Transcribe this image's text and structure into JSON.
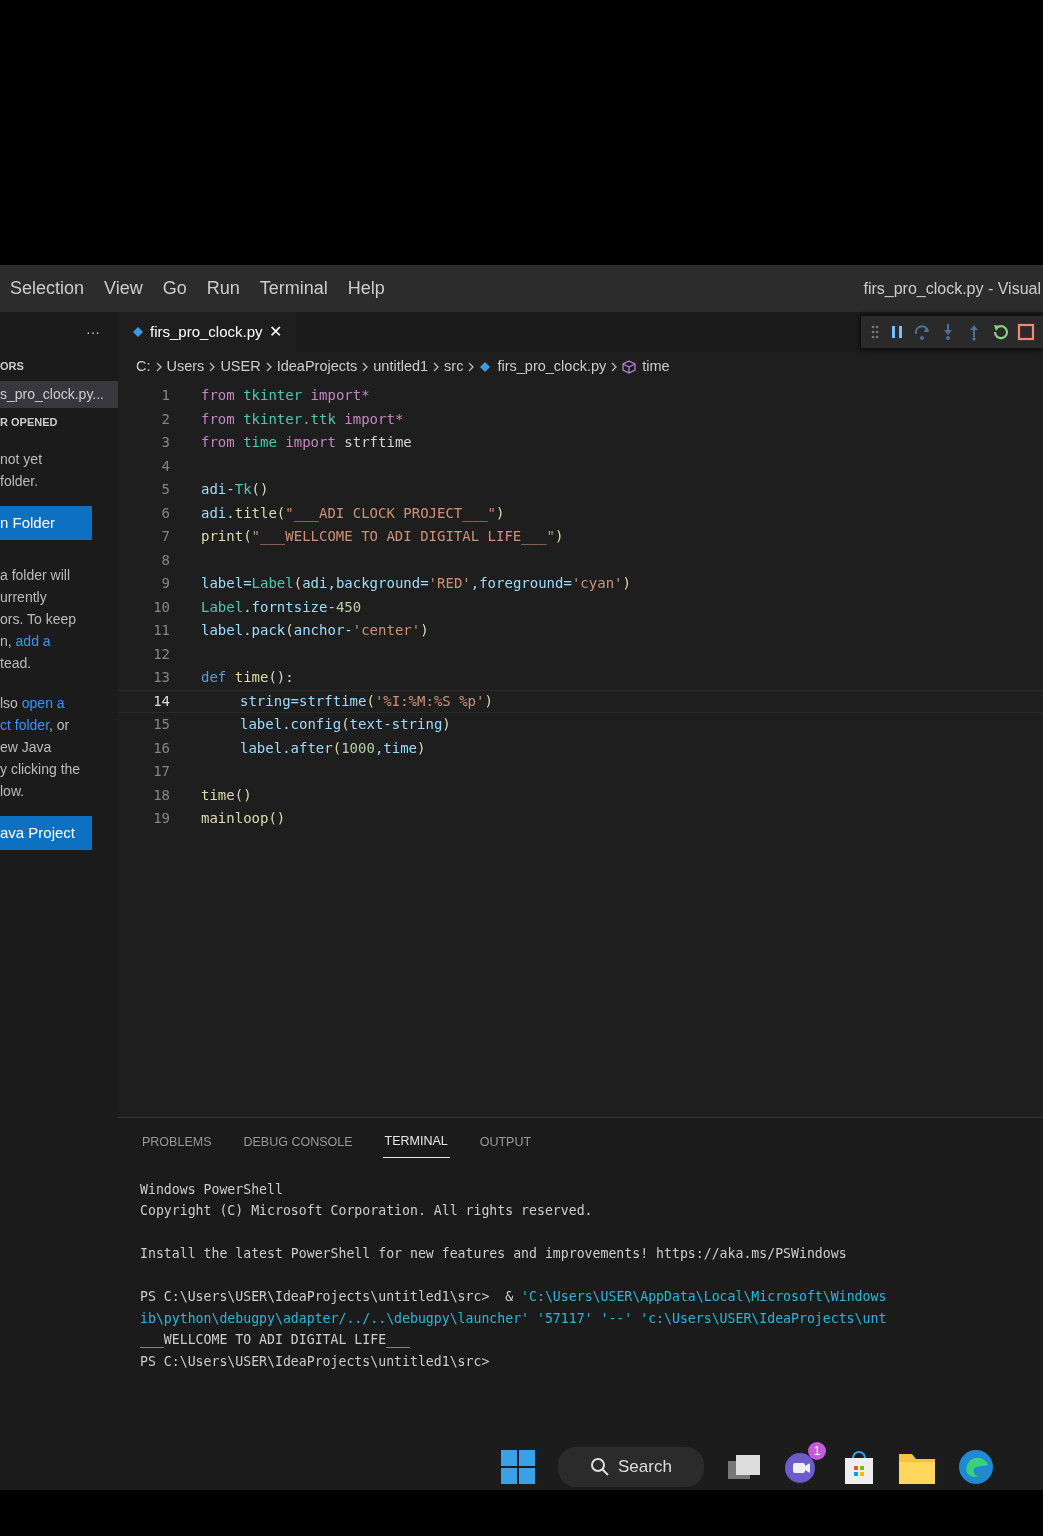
{
  "menu": [
    {
      "label": "Selection"
    },
    {
      "label": "View"
    },
    {
      "label": "Go"
    },
    {
      "label": "Run"
    },
    {
      "label": "Terminal"
    },
    {
      "label": "Help"
    }
  ],
  "window": {
    "title": "firs_pro_clock.py - Visual"
  },
  "sidebar": {
    "more": "···",
    "header": "ORS",
    "open_editor": "s_pro_clock.py...",
    "section": "R OPENED",
    "paragraphs": [
      [
        [
          {
            "text": "not yet",
            "link": false
          }
        ],
        [
          {
            "text": " folder.",
            "link": false
          }
        ]
      ],
      [
        [
          {
            "text": "a folder will",
            "link": false
          }
        ],
        [
          {
            "text": "urrently",
            "link": false
          }
        ],
        [
          {
            "text": "ors. To keep",
            "link": false
          }
        ],
        [
          {
            "text": "n, ",
            "link": false
          },
          {
            "text": "add a",
            "link": true
          }
        ],
        [
          {
            "text": "tead.",
            "link": false
          }
        ]
      ],
      [
        [
          {
            "text": "lso ",
            "link": false
          },
          {
            "text": "open a",
            "link": true
          }
        ],
        [
          {
            "text": "ct folder",
            "link": true
          },
          {
            "text": ", or",
            "link": false
          }
        ],
        [
          {
            "text": "ew Java",
            "link": false
          }
        ],
        [
          {
            "text": "y clicking the",
            "link": false
          }
        ],
        [
          {
            "text": "low.",
            "link": false
          }
        ]
      ]
    ],
    "buttons": [
      "n Folder",
      "ava Project"
    ]
  },
  "tab": {
    "label": "firs_pro_clock.py",
    "close": "✕",
    "selected": true
  },
  "breadcrumb": [
    {
      "label": "C:",
      "kind": "plain"
    },
    {
      "label": "Users",
      "kind": "plain"
    },
    {
      "label": "USER",
      "kind": "plain"
    },
    {
      "label": "IdeaProjects",
      "kind": "plain"
    },
    {
      "label": "untitled1",
      "kind": "plain"
    },
    {
      "label": "src",
      "kind": "plain"
    },
    {
      "label": "firs_pro_clock.py",
      "kind": "file"
    },
    {
      "label": "time",
      "kind": "symbol"
    }
  ],
  "code": [
    {
      "number": "1",
      "current": false,
      "tokens": [
        {
          "text": "from ",
          "kind": "keyword"
        },
        {
          "text": "tkinter ",
          "kind": "module"
        },
        {
          "text": "import*",
          "kind": "keyword"
        }
      ]
    },
    {
      "number": "2",
      "current": false,
      "tokens": [
        {
          "text": "from ",
          "kind": "keyword"
        },
        {
          "text": "tkinter.ttk ",
          "kind": "module"
        },
        {
          "text": "import*",
          "kind": "keyword"
        }
      ]
    },
    {
      "number": "3",
      "current": false,
      "tokens": [
        {
          "text": "from ",
          "kind": "keyword"
        },
        {
          "text": "time ",
          "kind": "module"
        },
        {
          "text": "import ",
          "kind": "keyword"
        },
        {
          "text": "strftime",
          "kind": "plain"
        }
      ]
    },
    {
      "number": "4",
      "current": false
    },
    {
      "number": "5",
      "current": false,
      "tokens": [
        {
          "text": "adi-",
          "kind": "variable"
        },
        {
          "text": "Tk",
          "kind": "module"
        },
        {
          "text": "()",
          "kind": "function"
        }
      ]
    },
    {
      "number": "6",
      "current": false,
      "tokens": [
        {
          "text": "adi.",
          "kind": "variable"
        },
        {
          "text": "title(",
          "kind": "function"
        },
        {
          "text": "\"___ADI CLOCK PROJECT___\"",
          "kind": "string"
        },
        {
          "text": ")",
          "kind": "function"
        }
      ]
    },
    {
      "number": "7",
      "current": false,
      "tokens": [
        {
          "text": "print(",
          "kind": "function"
        },
        {
          "text": "\"___WELLCOME TO ADI DIGITAL LIFE___\"",
          "kind": "string"
        },
        {
          "text": ")",
          "kind": "function"
        }
      ]
    },
    {
      "number": "8",
      "current": false
    },
    {
      "number": "9",
      "current": false,
      "tokens": [
        {
          "text": "label=",
          "kind": "variable"
        },
        {
          "text": "Label",
          "kind": "module"
        },
        {
          "text": "(",
          "kind": "function"
        },
        {
          "text": "adi,background=",
          "kind": "variable"
        },
        {
          "text": "'RED'",
          "kind": "string"
        },
        {
          "text": ",foreground=",
          "kind": "variable"
        },
        {
          "text": "'cyan'",
          "kind": "string"
        },
        {
          "text": ")",
          "kind": "function"
        }
      ]
    },
    {
      "number": "10",
      "current": false,
      "tokens": [
        {
          "text": "Label",
          "kind": "module"
        },
        {
          "text": ".forntsize-",
          "kind": "variable"
        },
        {
          "text": "450",
          "kind": "number"
        }
      ]
    },
    {
      "number": "11",
      "current": false,
      "tokens": [
        {
          "text": "label.pack",
          "kind": "variable"
        },
        {
          "text": "(",
          "kind": "function"
        },
        {
          "text": "anchor-",
          "kind": "variable"
        },
        {
          "text": "'center'",
          "kind": "string"
        },
        {
          "text": ")",
          "kind": "function"
        }
      ]
    },
    {
      "number": "12",
      "current": false
    },
    {
      "number": "13",
      "current": false,
      "tokens": [
        {
          "text": "def ",
          "kind": "def"
        },
        {
          "text": "time",
          "kind": "function"
        },
        {
          "text": "():",
          "kind": "plain"
        }
      ]
    },
    {
      "number": "14",
      "current": true,
      "indented": true,
      "tokens": [
        {
          "text": "string=strftime",
          "kind": "variable"
        },
        {
          "text": "(",
          "kind": "function"
        },
        {
          "text": "'%I:%M:%S %p'",
          "kind": "string"
        },
        {
          "text": ")",
          "kind": "function"
        }
      ]
    },
    {
      "number": "15",
      "current": false,
      "indented": true,
      "tokens": [
        {
          "text": "label.config",
          "kind": "variable"
        },
        {
          "text": "(",
          "kind": "function"
        },
        {
          "text": "text-string",
          "kind": "variable"
        },
        {
          "text": ")",
          "kind": "function"
        }
      ]
    },
    {
      "number": "16",
      "current": false,
      "indented": true,
      "tokens": [
        {
          "text": "label.after",
          "kind": "variable"
        },
        {
          "text": "(",
          "kind": "function"
        },
        {
          "text": "1000",
          "kind": "number"
        },
        {
          "text": ",time",
          "kind": "variable"
        },
        {
          "text": ")",
          "kind": "function"
        }
      ]
    },
    {
      "number": "17",
      "current": false
    },
    {
      "number": "18",
      "current": false,
      "tokens": [
        {
          "text": "time()",
          "kind": "function"
        }
      ]
    },
    {
      "number": "19",
      "current": false,
      "tokens": [
        {
          "text": "mainloop()",
          "kind": "function"
        }
      ]
    }
  ],
  "panel_tabs": [
    {
      "label": "PROBLEMS",
      "selected": false
    },
    {
      "label": "DEBUG CONSOLE",
      "selected": false
    },
    {
      "label": "TERMINAL",
      "selected": true
    },
    {
      "label": "OUTPUT",
      "selected": false
    }
  ],
  "terminal": [
    [
      [
        {
          "text": "Windows PowerShell",
          "kind": "plain"
        }
      ],
      [
        {
          "text": "Copyright (C) Microsoft Corporation. All rights reserved.",
          "kind": "plain"
        }
      ]
    ],
    [
      [
        {
          "text": "Install the latest PowerShell for new features and improvements! https://aka.ms/PSWindows",
          "kind": "plain"
        }
      ]
    ],
    [
      [
        {
          "text": "PS C:\\Users\\USER\\IdeaProjects\\untitled1\\src>  & ",
          "kind": "plain"
        },
        {
          "text": "'C:\\Users\\USER\\AppData\\Local\\Microsoft\\Windows",
          "kind": "string"
        }
      ],
      [
        {
          "text": "ib\\python\\debugpy\\adapter/../..\\debugpy\\launcher' '57117' '--' 'c:\\Users\\USER\\IdeaProjects\\unt",
          "kind": "string"
        }
      ],
      [
        {
          "text": "___WELLCOME TO ADI DIGITAL LIFE___",
          "kind": "plain"
        }
      ],
      [
        {
          "text": "PS C:\\Users\\USER\\IdeaProjects\\untitled1\\src>",
          "kind": "plain"
        }
      ]
    ]
  ],
  "taskbar": {
    "search": "Search",
    "chat_badge": "1"
  }
}
